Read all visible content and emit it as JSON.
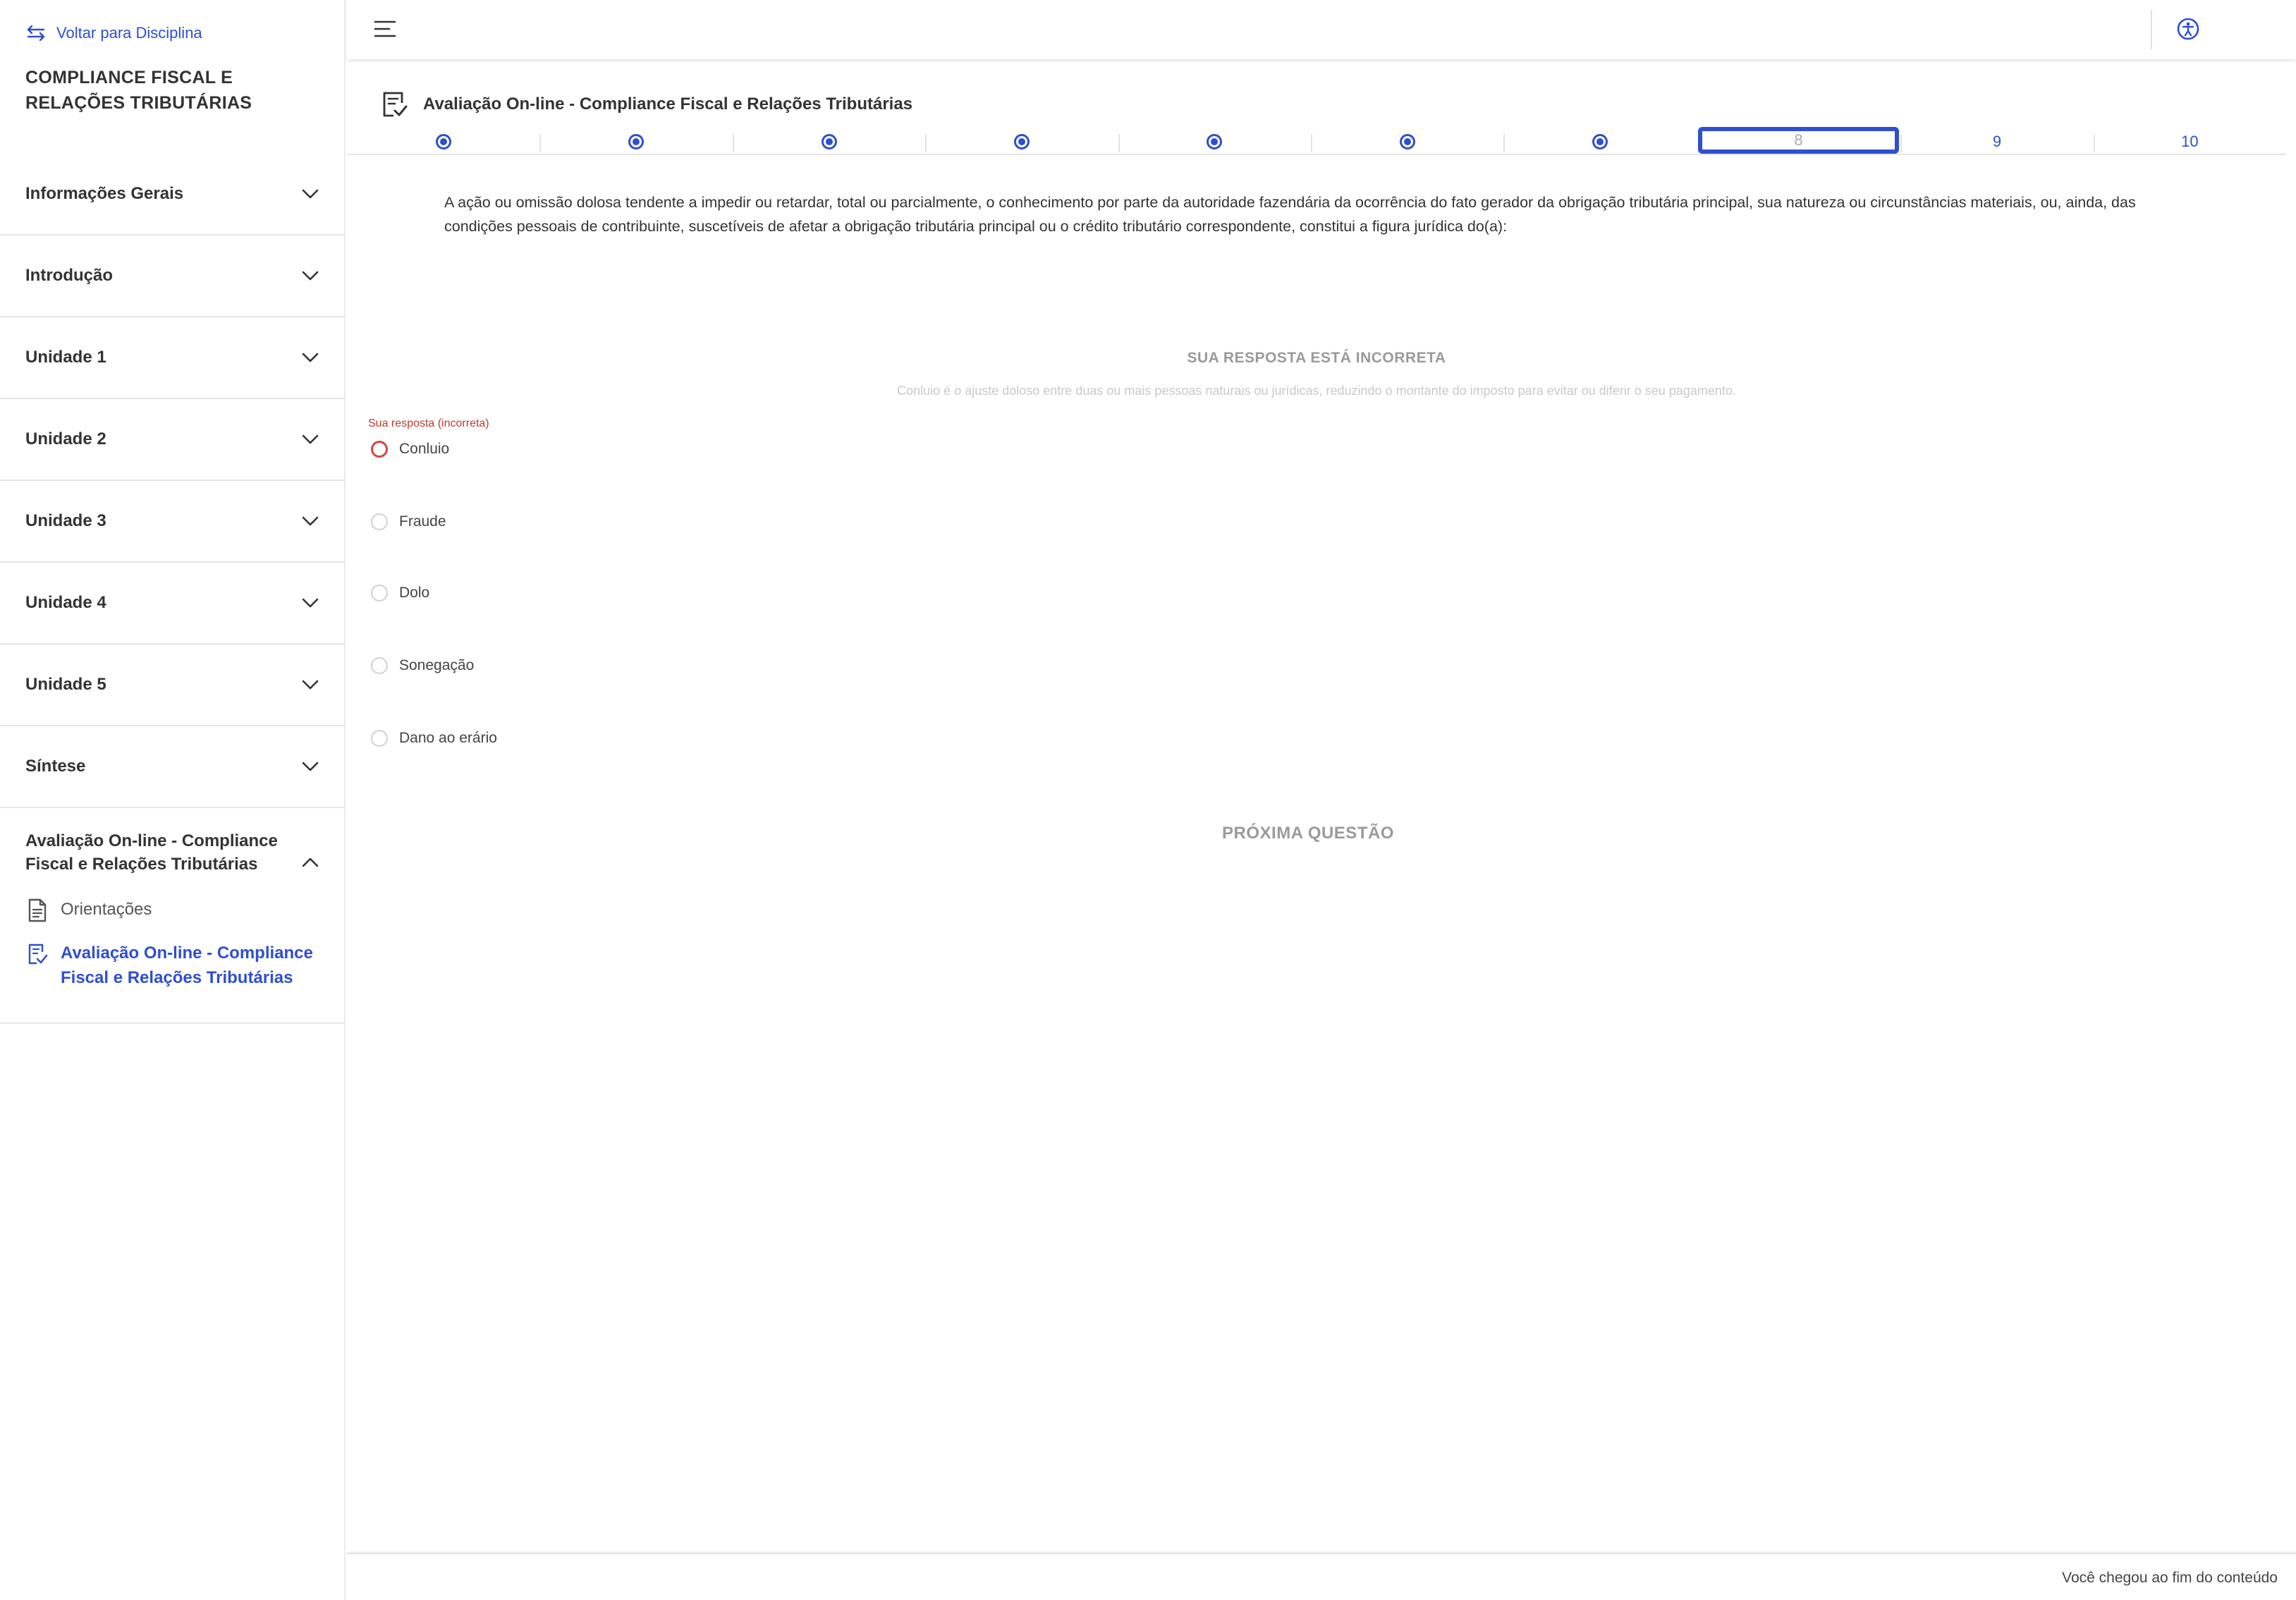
{
  "sidebar": {
    "back_label": "Voltar para Disciplina",
    "course_title": "COMPLIANCE FISCAL E RELAÇÕES TRIBUTÁRIAS",
    "items": [
      {
        "label": "Informações Gerais"
      },
      {
        "label": "Introdução"
      },
      {
        "label": "Unidade 1"
      },
      {
        "label": "Unidade 2"
      },
      {
        "label": "Unidade 3"
      },
      {
        "label": "Unidade 4"
      },
      {
        "label": "Unidade 5"
      },
      {
        "label": "Síntese"
      },
      {
        "label": "Avaliação On-line - Compliance Fiscal e Relações Tributárias"
      }
    ],
    "subitems": [
      {
        "label": "Orientações",
        "icon": "document-icon"
      },
      {
        "label": "Avaliação On-line - Compliance Fiscal e Relações Tributárias",
        "icon": "quiz-icon",
        "active": true
      }
    ]
  },
  "header": {
    "menu_icon": "hamburger-icon",
    "accessibility_icon": "accessibility-icon"
  },
  "main": {
    "title": "Avaliação On-line - Compliance Fiscal e Relações Tributárias",
    "question_nav": {
      "answered_count": 7,
      "current": "8",
      "labels": [
        "8",
        "9",
        "10"
      ]
    },
    "question_text": "A ação ou omissão dolosa tendente a impedir ou retardar, total ou parcialmente, o conhecimento por parte da autoridade fazendária da ocorrência do fato gerador da obrigação tributária principal, sua natureza ou circunstâncias materiais, ou, ainda, das condições pessoais de contribuinte, suscetíveis de afetar a obrigação tributária principal ou o crédito tributário correspondente, constitui a figura jurídica do(a):",
    "feedback_title": "SUA RESPOSTA ESTÁ INCORRETA",
    "feedback_text": "Conluio é o ajuste doloso entre duas ou mais pessoas naturais ou jurídicas, reduzindo o montante do imposto para evitar ou diferir o seu pagamento.",
    "your_answer_label": "Sua resposta (incorreta)",
    "options": [
      {
        "label": "Conluio"
      },
      {
        "label": "Fraude"
      },
      {
        "label": "Dolo"
      },
      {
        "label": "Sonegação"
      },
      {
        "label": "Dano ao erário"
      }
    ],
    "next_label": "PRÓXIMA QUESTÃO"
  },
  "footer": {
    "text": "Você chegou ao fim do conteúdo"
  },
  "colors": {
    "accent": "#2f4fcf",
    "error": "#d64545",
    "muted": "#9a9a9a"
  }
}
